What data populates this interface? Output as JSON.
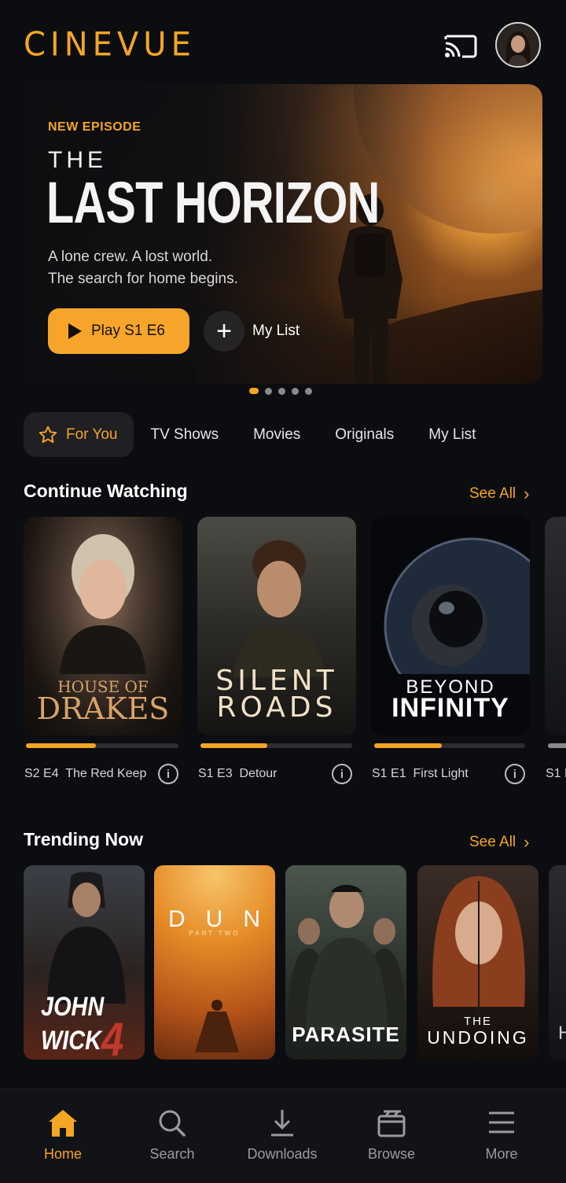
{
  "app": {
    "name": "CINEVUE"
  },
  "header": {
    "cast_icon": "cast-icon",
    "avatar": "profile-avatar"
  },
  "hero": {
    "tag": "NEW EPISODE",
    "title_small": "THE",
    "title_big": "LAST HORIZON",
    "description_line1": "A lone crew. A lost world.",
    "description_line2": "The search for home begins.",
    "play_label": "Play S1 E6",
    "mylist_label": "My List",
    "carousel": {
      "count": 5,
      "active_index": 0
    }
  },
  "tabs": [
    {
      "label": "For You",
      "icon": "star-icon",
      "active": true
    },
    {
      "label": "TV Shows"
    },
    {
      "label": "Movies"
    },
    {
      "label": "Originals"
    },
    {
      "label": "My List"
    }
  ],
  "continue_watching": {
    "title": "Continue Watching",
    "see_all": "See All",
    "items": [
      {
        "poster_line1": "HOUSE OF",
        "poster_line2": "DRAKES",
        "episode": "S2 E4",
        "episode_title": "The Red Keep",
        "progress": 0.46
      },
      {
        "poster_line1": "SILENT",
        "poster_line2": "ROADS",
        "episode": "S1 E3",
        "episode_title": "Detour",
        "progress": 0.44
      },
      {
        "poster_line1": "BEYOND",
        "poster_line2": "INFINITY",
        "episode": "S1 E1",
        "episode_title": "First Light",
        "progress": 0.45
      },
      {
        "episode": "S1 E"
      }
    ]
  },
  "trending": {
    "title": "Trending Now",
    "see_all": "See All",
    "items": [
      {
        "title_line1": "JOHN",
        "title_line2": "WICK",
        "title_num": "4"
      },
      {
        "title": "DUNE",
        "subtitle": "PART TWO"
      },
      {
        "title": "PARASITE"
      },
      {
        "title_line1": "THE",
        "title_line2": "UNDOING"
      },
      {
        "title": "H"
      }
    ]
  },
  "bottom_nav": [
    {
      "label": "Home",
      "icon": "home-icon",
      "active": true
    },
    {
      "label": "Search",
      "icon": "search-icon"
    },
    {
      "label": "Downloads",
      "icon": "download-icon"
    },
    {
      "label": "Browse",
      "icon": "clapperboard-icon"
    },
    {
      "label": "More",
      "icon": "menu-icon"
    }
  ],
  "colors": {
    "accent": "#f5a524",
    "background": "#0c0d11"
  }
}
